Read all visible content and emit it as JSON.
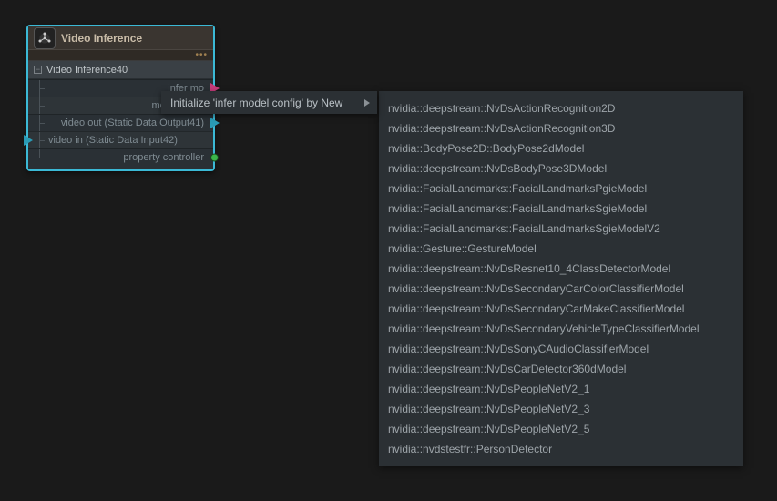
{
  "node": {
    "title": "Video Inference",
    "subtitle": "Video Inference40",
    "rows": [
      {
        "label": "infer mo",
        "port_out": "magenta"
      },
      {
        "label": "model upda",
        "port_out": null
      },
      {
        "label": "video out (Static Data Output41)",
        "port_out": "cyan"
      },
      {
        "label": "video in (Static Data Input42)",
        "port_in": "cyan"
      },
      {
        "label": "property controller",
        "port_out": "green"
      }
    ]
  },
  "context_menu": {
    "label": "Initialize 'infer model config' by New"
  },
  "dropdown": {
    "items": [
      "nvidia::deepstream::NvDsActionRecognition2D",
      "nvidia::deepstream::NvDsActionRecognition3D",
      "nvidia::BodyPose2D::BodyPose2dModel",
      "nvidia::deepstream::NvDsBodyPose3DModel",
      "nvidia::FacialLandmarks::FacialLandmarksPgieModel",
      "nvidia::FacialLandmarks::FacialLandmarksSgieModel",
      "nvidia::FacialLandmarks::FacialLandmarksSgieModelV2",
      "nvidia::Gesture::GestureModel",
      "nvidia::deepstream::NvDsResnet10_4ClassDetectorModel",
      "nvidia::deepstream::NvDsSecondaryCarColorClassifierModel",
      "nvidia::deepstream::NvDsSecondaryCarMakeClassifierModel",
      "nvidia::deepstream::NvDsSecondaryVehicleTypeClassifierModel",
      "nvidia::deepstream::NvDsSonyCAudioClassifierModel",
      "nvidia::deepstream::NvDsCarDetector360dModel",
      "nvidia::deepstream::NvDsPeopleNetV2_1",
      "nvidia::deepstream::NvDsPeopleNetV2_3",
      "nvidia::deepstream::NvDsPeopleNetV2_5",
      "nvidia::nvdstestfr::PersonDetector"
    ]
  }
}
